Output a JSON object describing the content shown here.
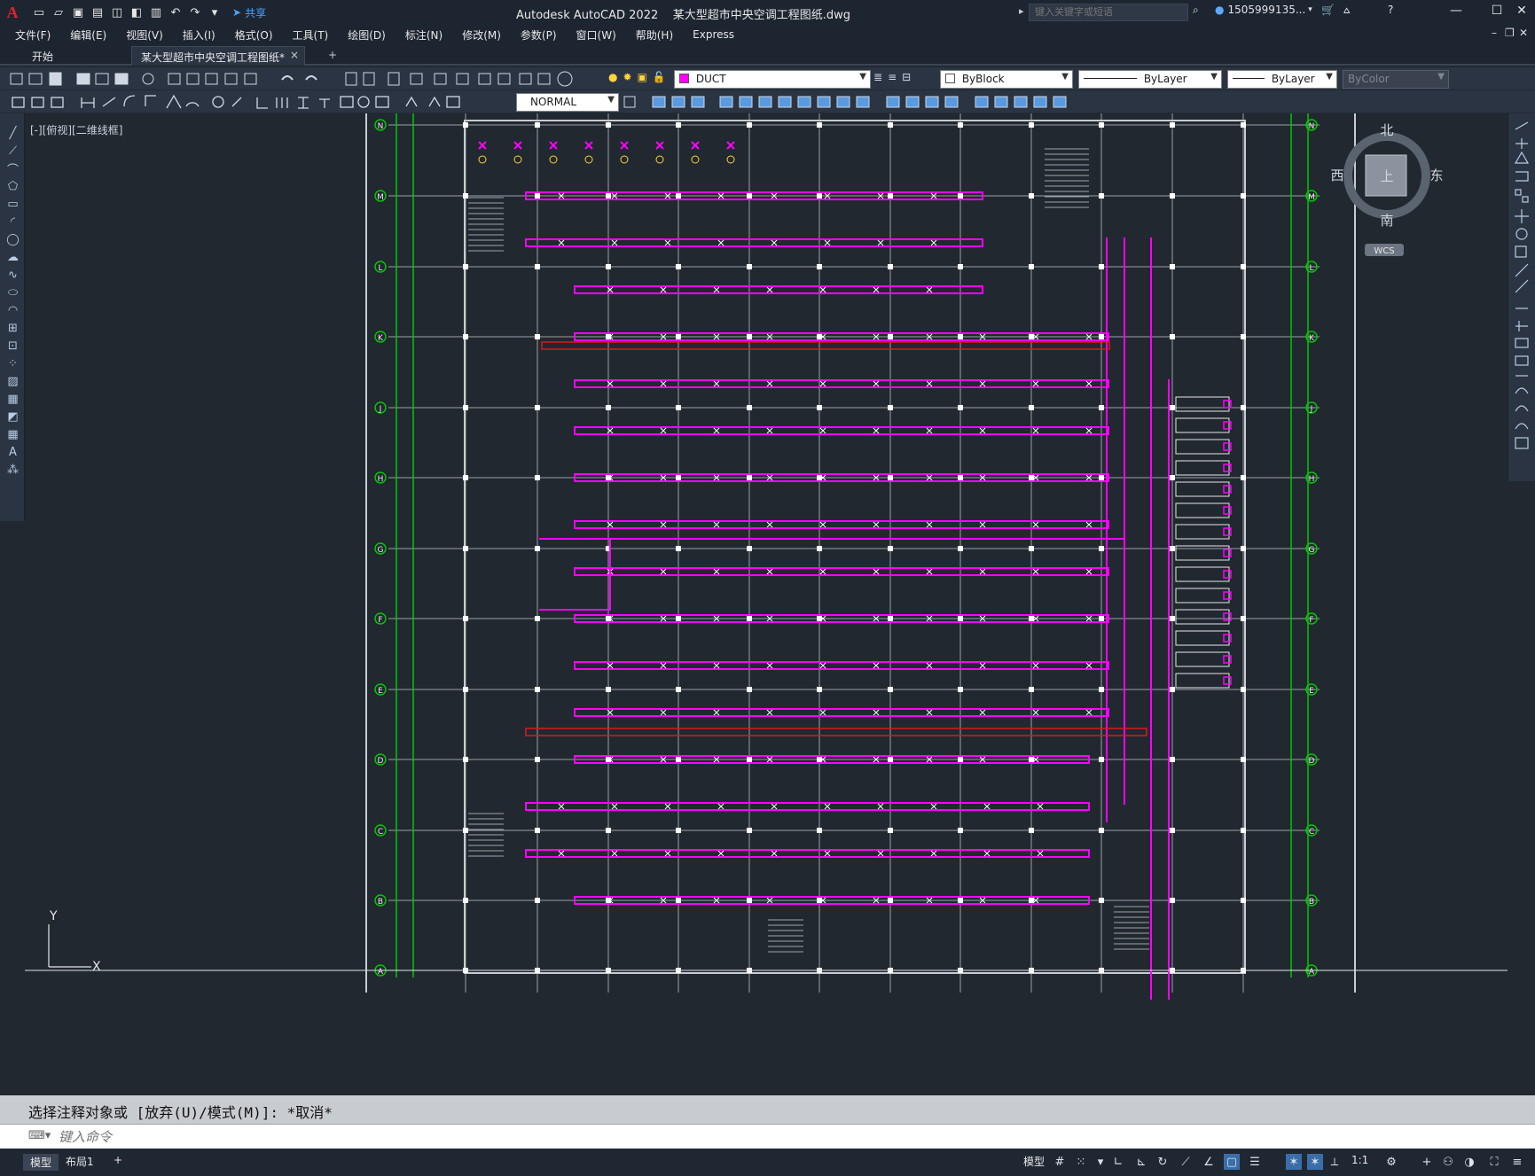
{
  "app": {
    "title": "Autodesk AutoCAD 2022    某大型超市中央空调工程图纸.dwg",
    "logo": "A",
    "share_label": "共享",
    "search_placeholder": "键入关键字或短语",
    "user": "1505999135...",
    "accent": "#e0232f"
  },
  "menus": [
    "文件(F)",
    "编辑(E)",
    "视图(V)",
    "插入(I)",
    "格式(O)",
    "工具(T)",
    "绘图(D)",
    "标注(N)",
    "修改(M)",
    "参数(P)",
    "窗口(W)",
    "帮助(H)",
    "Express"
  ],
  "tabs": {
    "start": "开始",
    "active": "某大型超市中央空调工程图纸*",
    "close": "×",
    "add": "+"
  },
  "layers": {
    "current_layer": "DUCT",
    "layer_color": "#ff00ff",
    "color": "ByBlock",
    "linetype": "ByLayer",
    "lineweight": "ByLayer",
    "plotstyle": "ByColor",
    "dimstyle": "NORMAL"
  },
  "viewport": {
    "label": "[-][俯视][二维线框]",
    "grid_letters": [
      "N",
      "M",
      "L",
      "K",
      "J",
      "H",
      "G",
      "F",
      "E",
      "D",
      "C",
      "B",
      "A"
    ],
    "compass": {
      "north": "北",
      "south": "南",
      "east": "东",
      "west": "西",
      "top": "上",
      "wcs": "WCS"
    },
    "ucs": {
      "y": "Y",
      "x": "X"
    },
    "duct_color": "#ff00ff",
    "axis_color": "#00c800",
    "pipe_color": "#d81b1b"
  },
  "command": {
    "history": "选择注释对象或 [放弃(U)/模式(M)]: *取消*",
    "placeholder": "键入命令"
  },
  "status": {
    "model_tab": "模型",
    "layout_tab": "布局1",
    "add": "+",
    "model_label": "模型",
    "scale": "1:1"
  }
}
